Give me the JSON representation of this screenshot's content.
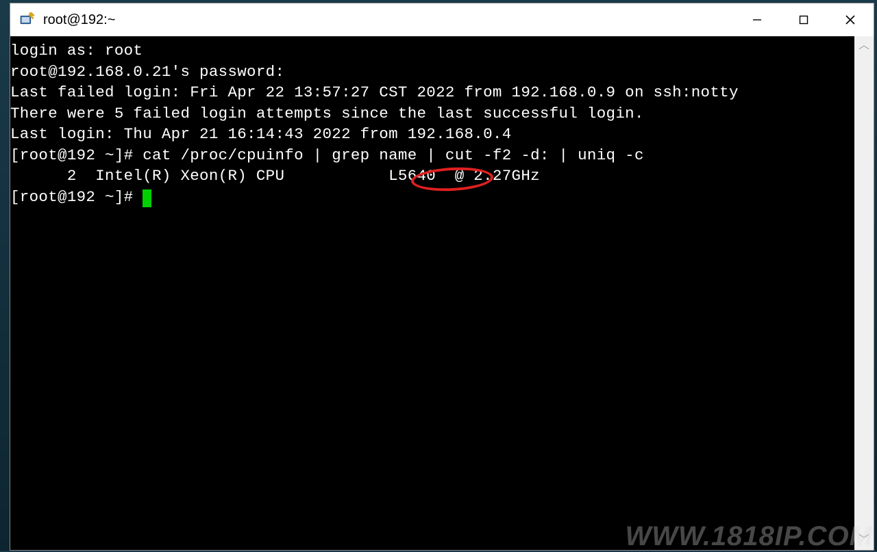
{
  "window": {
    "title": "root@192:~"
  },
  "terminal": {
    "lines": [
      "login as: root",
      "root@192.168.0.21's password:",
      "Last failed login: Fri Apr 22 13:57:27 CST 2022 from 192.168.0.9 on ssh:notty",
      "There were 5 failed login attempts since the last successful login.",
      "Last login: Thu Apr 21 16:14:43 2022 from 192.168.0.4",
      "[root@192 ~]# cat /proc/cpuinfo | grep name | cut -f2 -d: | uniq -c",
      "      2  Intel(R) Xeon(R) CPU           L5640  @ 2.27GHz",
      "[root@192 ~]# "
    ],
    "highlighted_text": "L5640"
  },
  "watermark": "WWW.1818IP.COM"
}
